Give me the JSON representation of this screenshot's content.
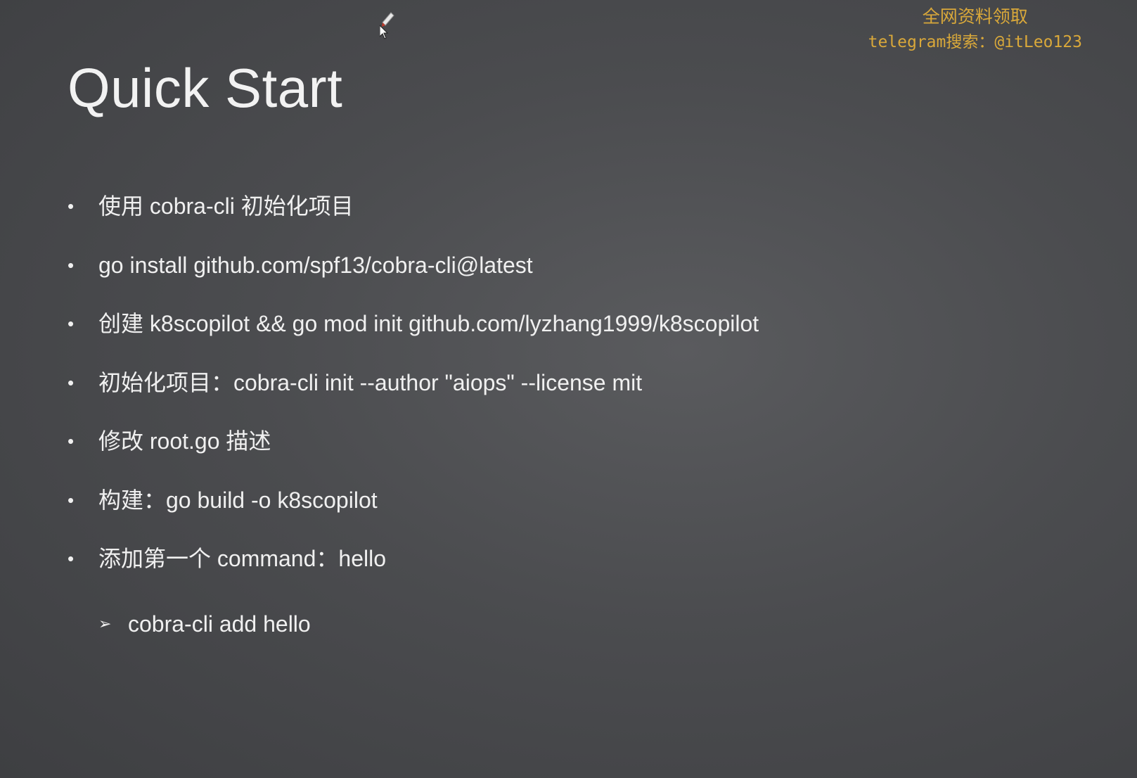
{
  "watermark": {
    "line1": "全网资料领取",
    "line2": "telegram搜索：@itLeo123"
  },
  "slide": {
    "title": "Quick Start",
    "bullets": [
      "使用 cobra-cli 初始化项目",
      "go install github.com/spf13/cobra-cli@latest",
      "创建 k8scopilot && go mod init github.com/lyzhang1999/k8scopilot",
      "初始化项目：cobra-cli init --author \"aiops\" --license mit",
      "修改 root.go 描述",
      "构建：go build -o k8scopilot",
      "添加第一个 command：hello"
    ],
    "sub_bullets": [
      "cobra-cli add hello"
    ]
  },
  "colors": {
    "background": "#4b4c4f",
    "text": "#f0f0f0",
    "watermark": "#d9a83a"
  }
}
